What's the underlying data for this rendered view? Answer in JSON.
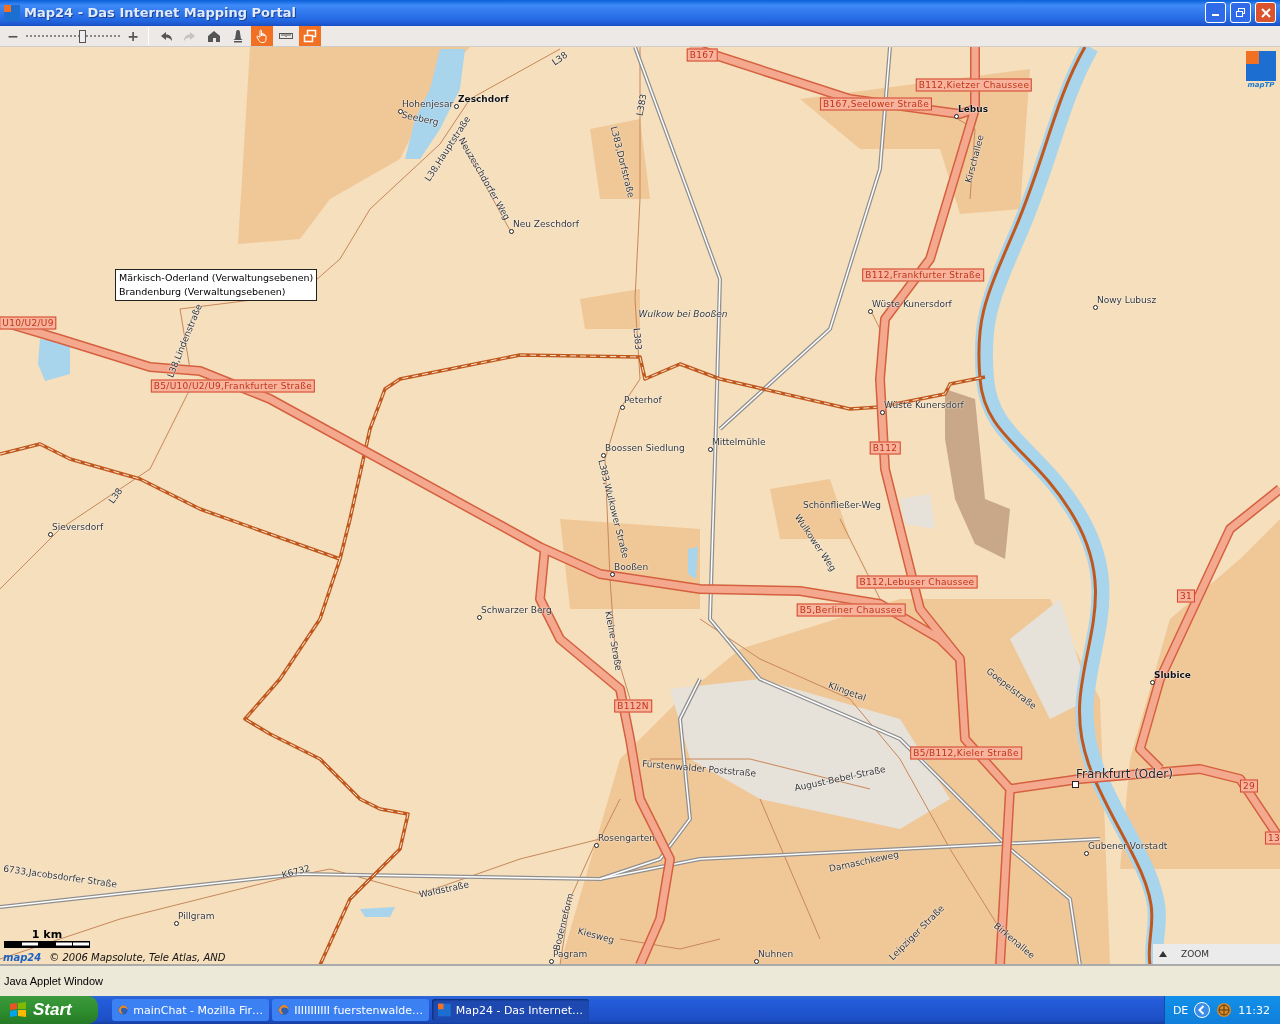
{
  "window": {
    "title": "Map24 - Das Internet Mapping Portal"
  },
  "toolbar": {
    "zoom_out": "−",
    "zoom_slider": {
      "level": 0.6
    },
    "zoom_in": "+",
    "tools": [
      {
        "kind": "back",
        "disabled": false,
        "selected": false
      },
      {
        "kind": "forward",
        "disabled": true,
        "selected": false
      },
      {
        "kind": "home",
        "disabled": false,
        "selected": false
      },
      {
        "kind": "bell",
        "disabled": false,
        "selected": false
      },
      {
        "kind": "hand",
        "disabled": false,
        "selected": true
      },
      {
        "kind": "ruler",
        "disabled": false,
        "selected": false
      },
      {
        "kind": "window",
        "disabled": false,
        "selected": true
      }
    ]
  },
  "map": {
    "logo": "mapTP",
    "labels": [
      {
        "kind": "shield",
        "text": "B167"
      },
      {
        "kind": "shield",
        "text": "B112,Kietzer Chaussee"
      },
      {
        "kind": "shield",
        "text": "B167,Seelower Straße"
      },
      {
        "kind": "shield",
        "text": "B112,Frankfurter Straße"
      },
      {
        "kind": "shield",
        "text": "U10/U2/U9"
      },
      {
        "kind": "shield",
        "text": "B5/U10/U2/U9,Frankfurter Straße"
      },
      {
        "kind": "shield",
        "text": "B112"
      },
      {
        "kind": "shield",
        "text": "B112,Lebuser Chaussee"
      },
      {
        "kind": "shield",
        "text": "B5,Berliner Chaussee"
      },
      {
        "kind": "shield",
        "text": "31"
      },
      {
        "kind": "shield",
        "text": "B112N"
      },
      {
        "kind": "shield",
        "text": "B5/B112,Kieler Straße"
      },
      {
        "kind": "shield",
        "text": "29"
      },
      {
        "kind": "shield",
        "text": "13"
      },
      {
        "kind": "place",
        "text": "Hohenjesar"
      },
      {
        "kind": "town",
        "text": "Zeschdorf"
      },
      {
        "kind": "place",
        "text": "Neu Zeschdorf"
      },
      {
        "kind": "town",
        "text": "Lebus"
      },
      {
        "kind": "place",
        "text": "Wüste Kunersdorf"
      },
      {
        "kind": "place",
        "text": "Nowy Lubusz"
      },
      {
        "kind": "place",
        "text": "Peterhof"
      },
      {
        "kind": "place",
        "text": "Wüste Kunersdorf"
      },
      {
        "kind": "place",
        "text": "Boossen Siedlung"
      },
      {
        "kind": "place",
        "text": "Mittelmühle"
      },
      {
        "kind": "place",
        "text": "Sieversdorf"
      },
      {
        "kind": "place",
        "text": "Booßen"
      },
      {
        "kind": "place",
        "text": "Schwarzer Berg"
      },
      {
        "kind": "town",
        "text": "Slubice"
      },
      {
        "kind": "city",
        "text": "Frankfurt (Oder)"
      },
      {
        "kind": "place",
        "text": "Rosengarten"
      },
      {
        "kind": "place",
        "text": "Gubener Vorstadt"
      },
      {
        "kind": "place",
        "text": "Pillgram"
      },
      {
        "kind": "place",
        "text": "Pagram"
      },
      {
        "kind": "place",
        "text": "Nuhnen"
      },
      {
        "kind": "street",
        "text": "L38"
      },
      {
        "kind": "street",
        "text": "Seeberg"
      },
      {
        "kind": "street",
        "text": "L38,Hauptstraße"
      },
      {
        "kind": "street",
        "text": "Neuzeschdorfer Weg"
      },
      {
        "kind": "street",
        "text": "L383"
      },
      {
        "kind": "street",
        "text": "L383,Dorfstraße"
      },
      {
        "kind": "street",
        "text": "Kirschallee"
      },
      {
        "kind": "street",
        "text": "L38,Lindenstraße"
      },
      {
        "kind": "area",
        "text": "Wulkow bei Booßen"
      },
      {
        "kind": "street",
        "text": "L383"
      },
      {
        "kind": "street",
        "text": "L38"
      },
      {
        "kind": "street",
        "text": "L383,Wulkower Straße"
      },
      {
        "kind": "street",
        "text": "Schönfließer-Weg"
      },
      {
        "kind": "street",
        "text": "Wulkower Weg"
      },
      {
        "kind": "street",
        "text": "Kleine Straße"
      },
      {
        "kind": "street",
        "text": "Klingetal"
      },
      {
        "kind": "street",
        "text": "Goepelstraße"
      },
      {
        "kind": "street",
        "text": "Fürstenwalder Poststraße"
      },
      {
        "kind": "street",
        "text": "August-Bebel-Straße"
      },
      {
        "kind": "street",
        "text": "6733,Jacobsdorfer Straße"
      },
      {
        "kind": "street",
        "text": "K6732"
      },
      {
        "kind": "street",
        "text": "Waldstraße"
      },
      {
        "kind": "street",
        "text": "Damaschkeweg"
      },
      {
        "kind": "street",
        "text": "Bodenreform"
      },
      {
        "kind": "street",
        "text": "Kiesweg"
      },
      {
        "kind": "street",
        "text": "Leipziger Straße"
      },
      {
        "kind": "street",
        "text": "Birkenallee"
      }
    ],
    "tooltip": [
      "Märkisch-Oderland (Verwaltungsebenen)",
      "Brandenburg (Verwaltungsebenen)"
    ],
    "scale": "1 km",
    "brand": "map24",
    "copyright": "© 2006 Mapsolute, Tele Atlas, AND",
    "zoom_panel": "ZOOM"
  },
  "status_bar": "Java Applet Window",
  "taskbar": {
    "start": "Start",
    "tasks": [
      {
        "kind": "browser",
        "label": "mainChat - Mozilla Fir…",
        "selected": false
      },
      {
        "kind": "browser",
        "label": "IIIIIIIIIII fuerstenwalde…",
        "selected": false
      },
      {
        "kind": "applet",
        "label": "Map24 - Das Internet…",
        "selected": true
      }
    ],
    "language": "DE",
    "clock": "11:32"
  }
}
